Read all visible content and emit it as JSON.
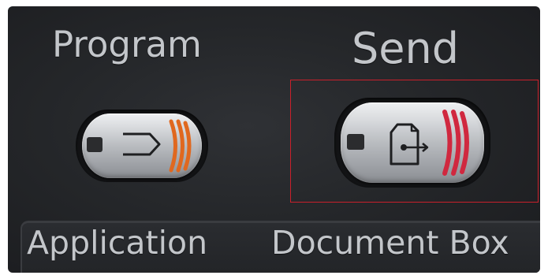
{
  "labels": {
    "program": "Program",
    "send": "Send",
    "application": "Application",
    "document_box": "Document Box"
  },
  "buttons": [
    {
      "id": "program",
      "icon": "program-icon",
      "stripe_color": "#e0681f"
    },
    {
      "id": "send",
      "icon": "document-send-icon",
      "stripe_color": "#d0283f",
      "highlighted": true
    }
  ],
  "colors": {
    "panel": "#26282b",
    "label_text": "#c3c6ca",
    "highlight_border": "#c9202b",
    "program_accent": "#e0681f",
    "send_accent": "#d0283f"
  }
}
